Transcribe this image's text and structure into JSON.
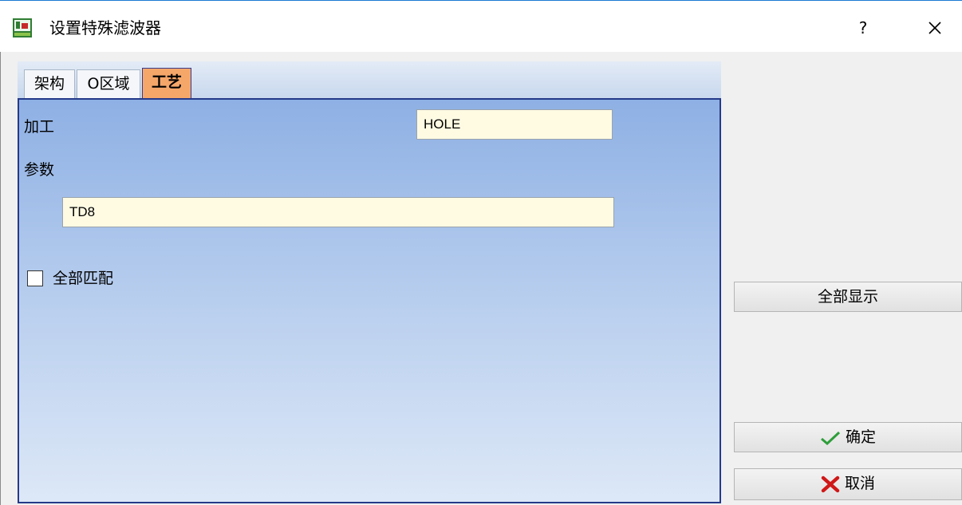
{
  "window": {
    "title": "设置特殊滤波器",
    "help_label": "?"
  },
  "tabs": [
    {
      "label": "架构"
    },
    {
      "label": "O区域"
    },
    {
      "label": "工艺",
      "active": true
    }
  ],
  "form": {
    "processing_label": "加工",
    "processing_value": "HOLE",
    "parameters_label": "参数",
    "parameters_value": "TD8",
    "match_all_label": "全部匹配",
    "match_all_checked": false
  },
  "buttons": {
    "show_all": "全部显示",
    "ok": "确定",
    "cancel": "取消"
  },
  "colors": {
    "accent_tab": "#f5a76a",
    "panel_border": "#253a8a",
    "field_bg": "#fffbe3"
  }
}
